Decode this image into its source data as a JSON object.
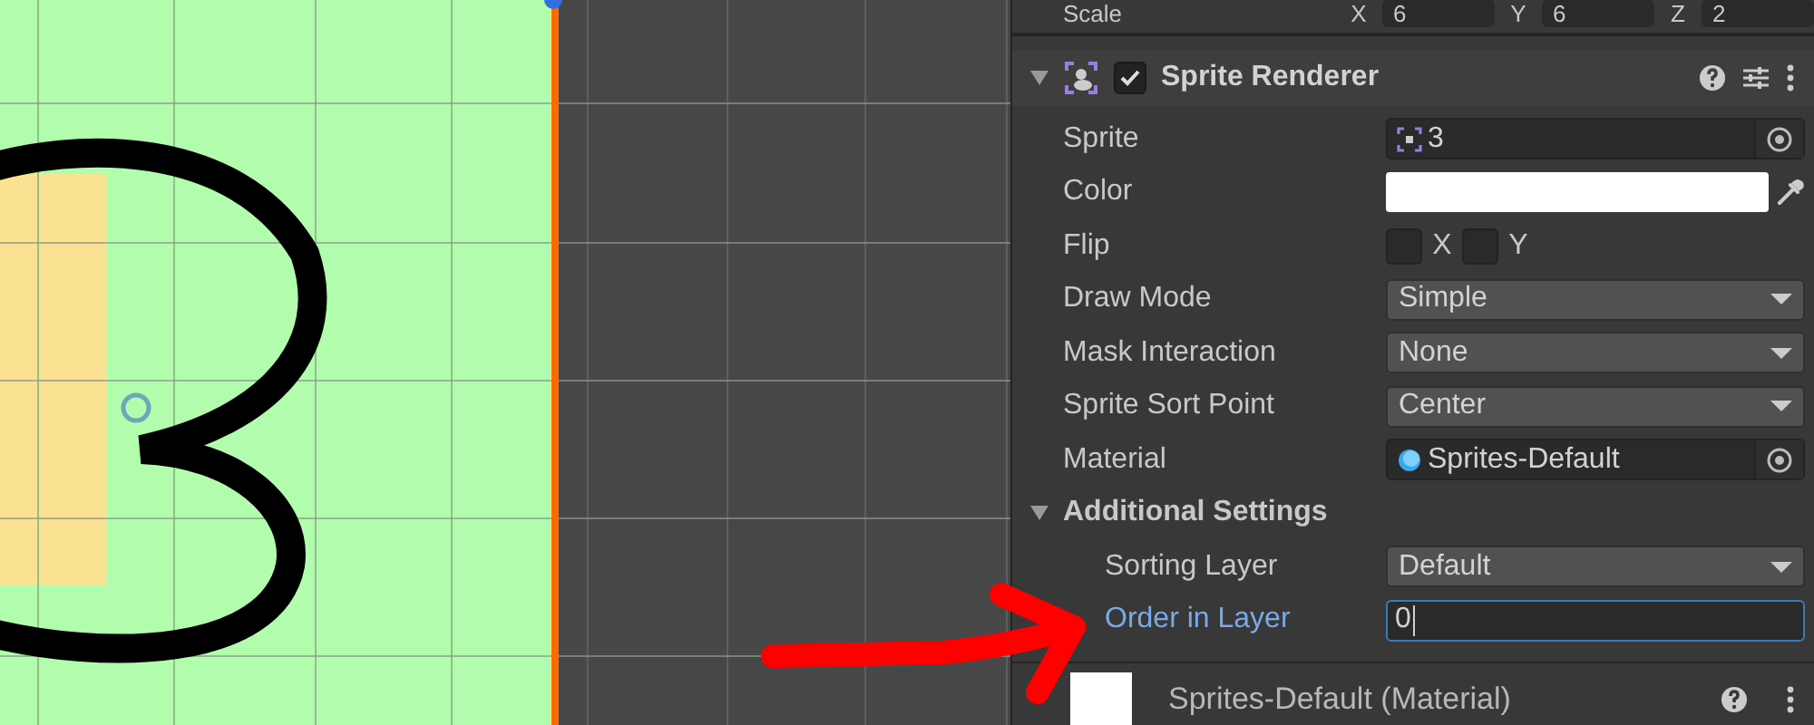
{
  "transform_row": {
    "label": "Scale",
    "axes": [
      {
        "axis": "X",
        "value": "6"
      },
      {
        "axis": "Y",
        "value": "6"
      },
      {
        "axis": "Z",
        "value": "2"
      }
    ]
  },
  "component": {
    "title": "Sprite Renderer",
    "enabled": true,
    "expanded": true,
    "fields": [
      {
        "kind": "sprite-object",
        "label": "Sprite",
        "value": "3"
      },
      {
        "kind": "color",
        "label": "Color",
        "color": "#ffffff"
      },
      {
        "kind": "flip",
        "label": "Flip",
        "options": [
          {
            "label": "X",
            "checked": false
          },
          {
            "label": "Y",
            "checked": false
          }
        ]
      },
      {
        "kind": "dropdown",
        "label": "Draw Mode",
        "value": "Simple"
      },
      {
        "kind": "dropdown",
        "label": "Mask Interaction",
        "value": "None"
      },
      {
        "kind": "dropdown",
        "label": "Sprite Sort Point",
        "value": "Center"
      },
      {
        "kind": "material-object",
        "label": "Material",
        "value": "Sprites-Default"
      }
    ],
    "additional": {
      "title": "Additional Settings",
      "expanded": true,
      "fields": [
        {
          "kind": "dropdown",
          "label": "Sorting Layer",
          "value": "Default",
          "focused": false
        },
        {
          "kind": "number",
          "label": "Order in Layer",
          "value": "0",
          "focused": true
        }
      ]
    }
  },
  "material": {
    "title": "Sprites-Default (Material)"
  }
}
